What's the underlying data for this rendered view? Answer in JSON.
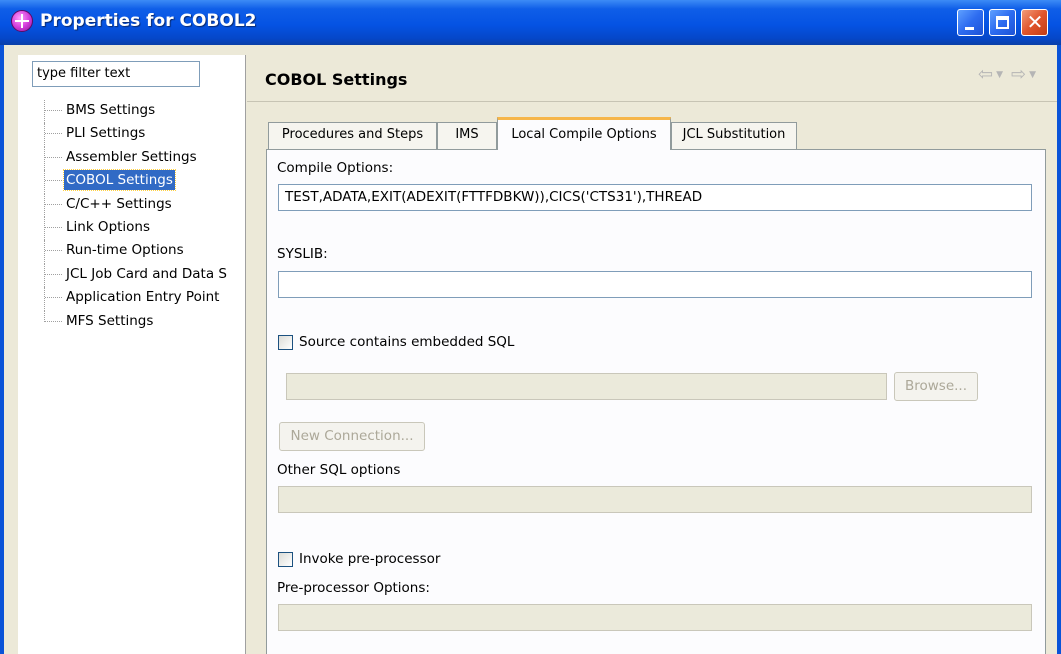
{
  "window": {
    "title": "Properties for COBOL2"
  },
  "filter": {
    "placeholder": "type filter text"
  },
  "tree": {
    "items": [
      {
        "label": "BMS Settings"
      },
      {
        "label": "PLI Settings"
      },
      {
        "label": "Assembler Settings"
      },
      {
        "label": "COBOL Settings",
        "selected": true
      },
      {
        "label": "C/C++ Settings"
      },
      {
        "label": "Link Options"
      },
      {
        "label": "Run-time Options"
      },
      {
        "label": "JCL Job Card and Data S"
      },
      {
        "label": "Application Entry Point"
      },
      {
        "label": "MFS Settings"
      }
    ]
  },
  "header": {
    "title": "COBOL Settings",
    "back_icon": "back-arrow-icon",
    "forward_icon": "forward-arrow-icon"
  },
  "tabs": [
    {
      "label": "Procedures and Steps"
    },
    {
      "label": "IMS"
    },
    {
      "label": "Local Compile Options",
      "active": true
    },
    {
      "label": "JCL Substitution"
    }
  ],
  "panel": {
    "compile_options_label": "Compile Options:",
    "compile_options_value": "TEST,ADATA,EXIT(ADEXIT(FTTFDBKW)),CICS('CTS31'),THREAD",
    "syslib_label": "SYSLIB:",
    "syslib_value": "",
    "embedded_sql_label": "Source contains embedded SQL",
    "embedded_sql_checked": false,
    "sql_path_value": "",
    "browse_label": "Browse...",
    "new_connection_label": "New Connection...",
    "other_sql_label": "Other SQL options",
    "other_sql_value": "",
    "preprocessor_label": "Invoke pre-processor",
    "preprocessor_checked": false,
    "preprocessor_options_label": "Pre-processor Options:",
    "preprocessor_options_value": ""
  },
  "colors": {
    "titlebar": "#0553e3",
    "selection": "#316ac5",
    "active_tab_accent": "#f6b64a",
    "dialog_bg": "#ece9d8"
  }
}
